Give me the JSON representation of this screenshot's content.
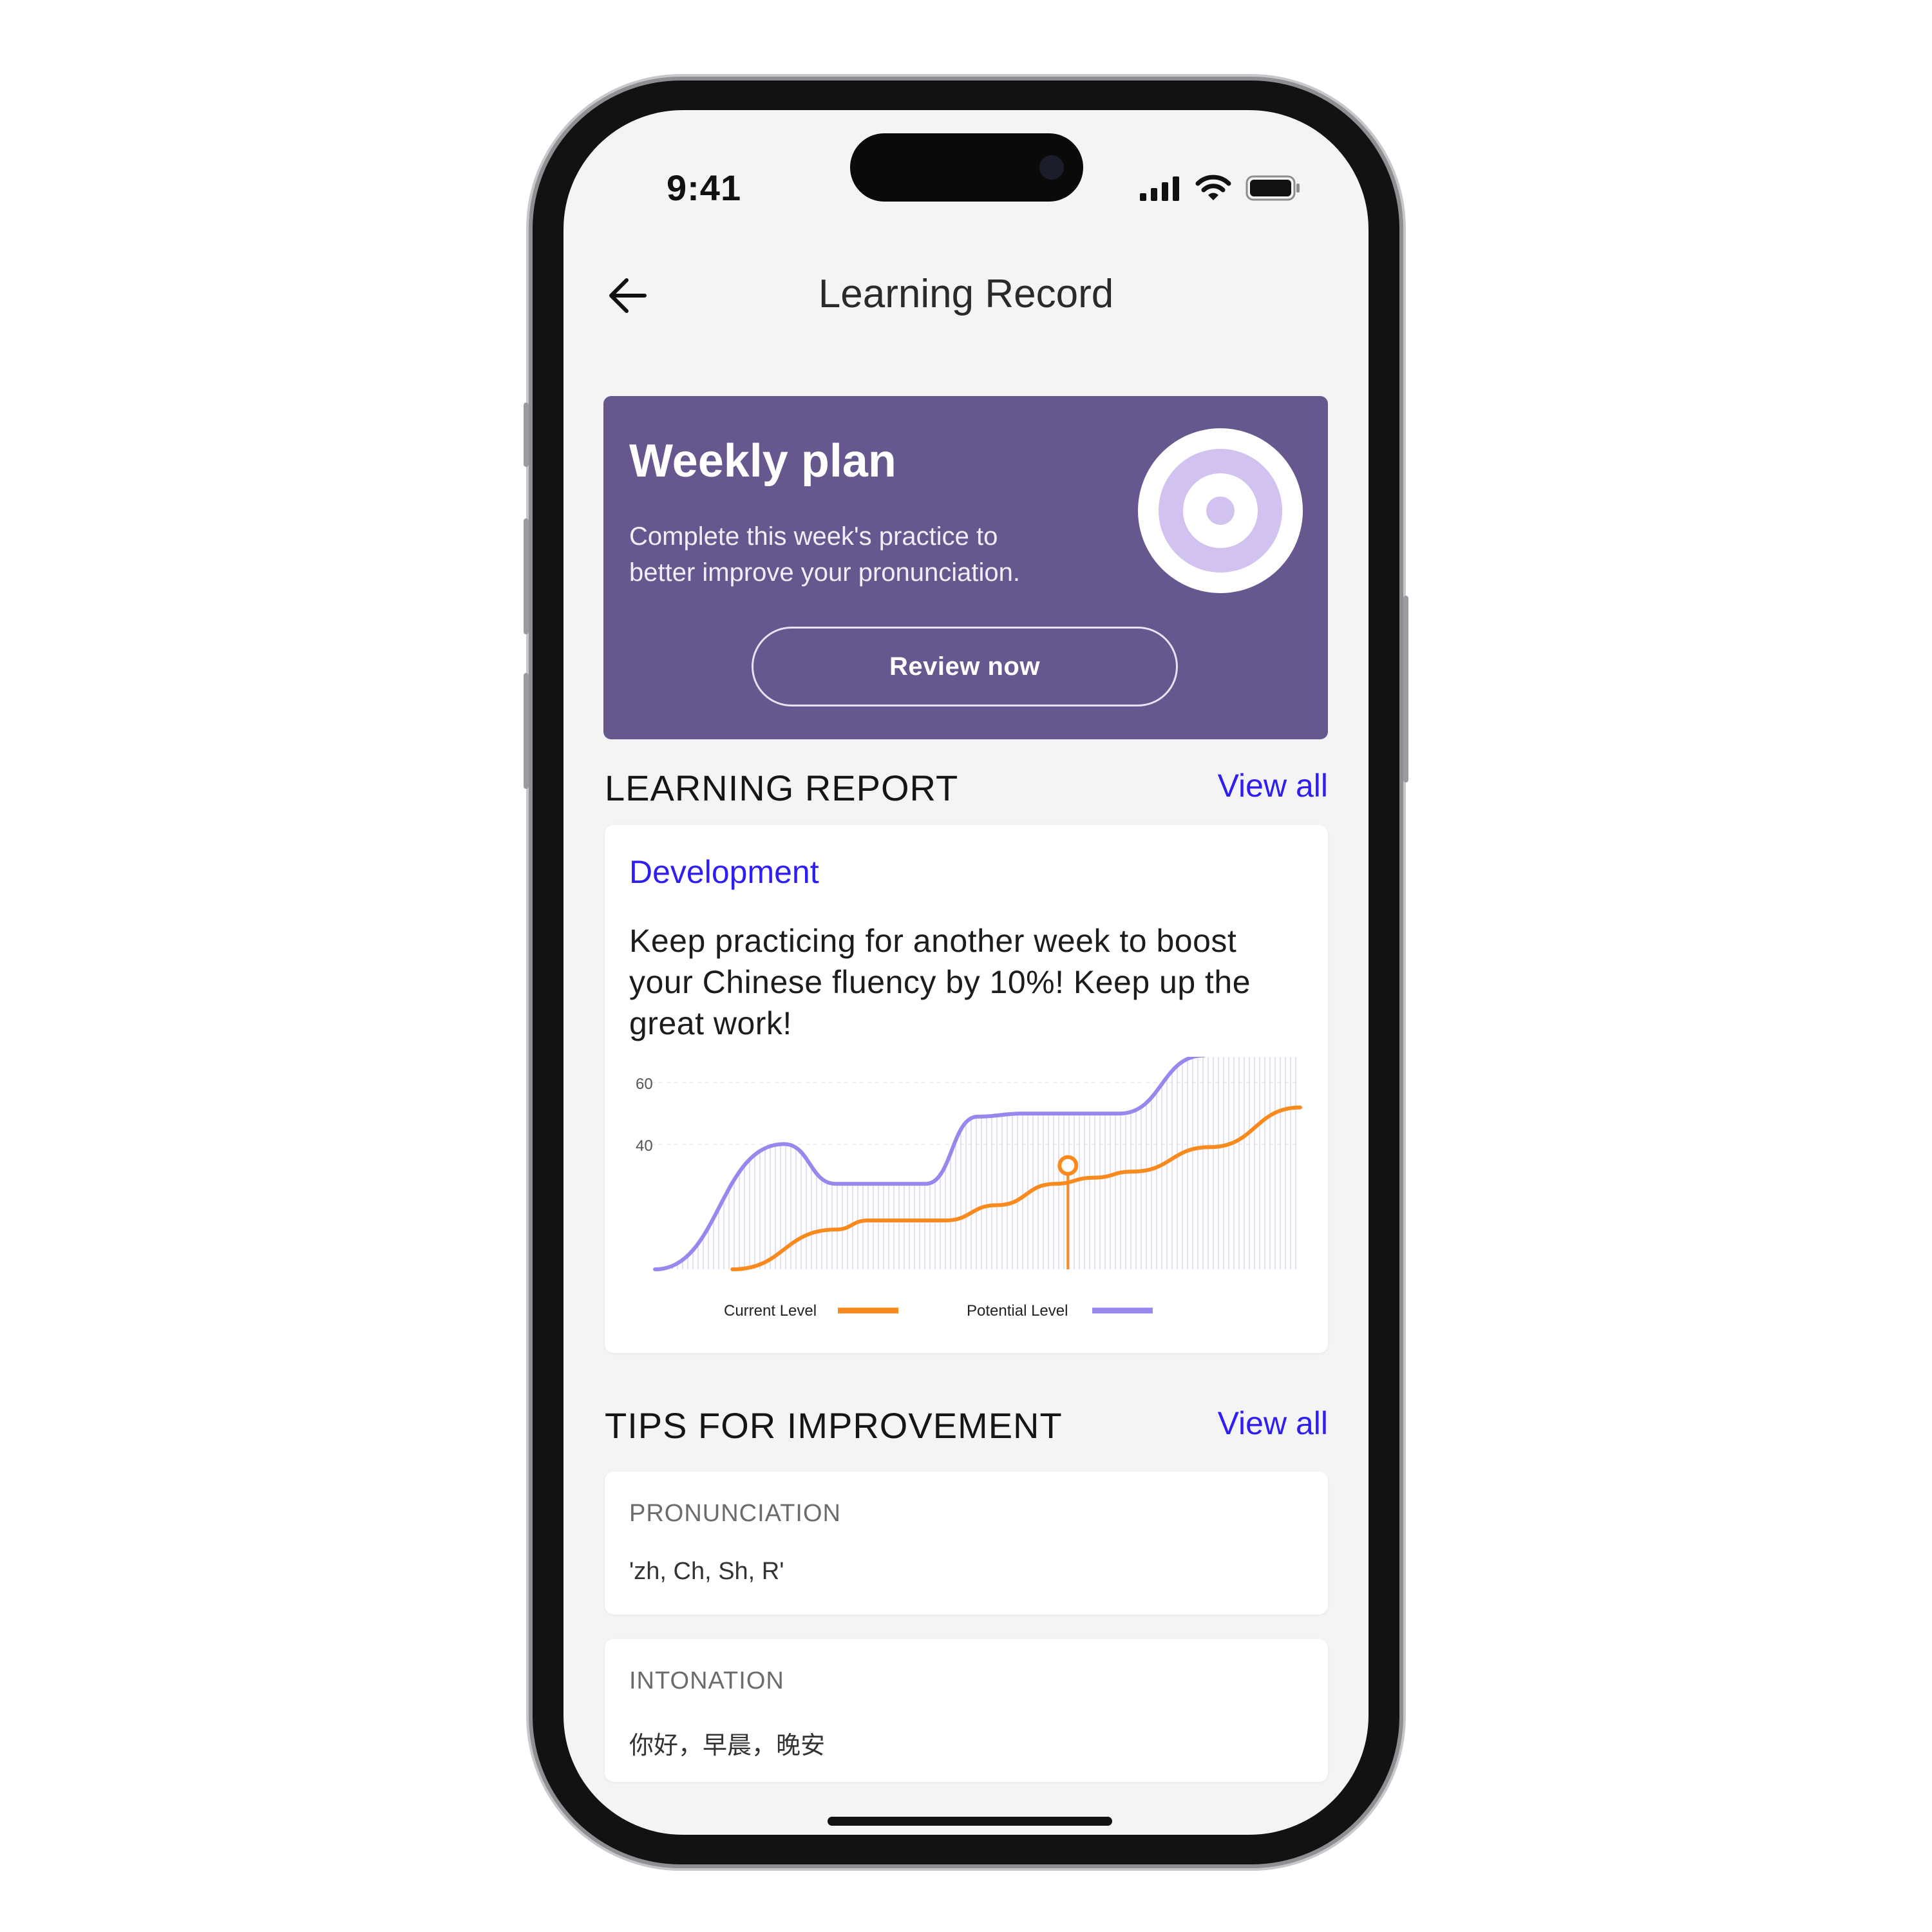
{
  "status_bar": {
    "time": "9:41"
  },
  "nav": {
    "title": "Learning Record"
  },
  "weekly_plan": {
    "title": "Weekly plan",
    "description_line1": "Complete this week's practice to",
    "description_line2": "better improve your pronunciation.",
    "button_label": "Review now",
    "card_color": "#66578e"
  },
  "learning_report": {
    "section_title": "LEARNING REPORT",
    "view_all": "View all",
    "subtitle": "Development",
    "message": "Keep practicing for another week to boost your Chinese fluency by 10%! Keep up the great work!"
  },
  "chart_data": {
    "type": "line",
    "ylim": [
      0,
      70
    ],
    "y_ticks": [
      "60",
      "40"
    ],
    "grid": true,
    "legend_position": "bottom",
    "series": [
      {
        "name": "Current Level",
        "color": "#f98a1d",
        "points": [
          [
            0.12,
            0
          ],
          [
            0.28,
            13
          ],
          [
            0.33,
            16
          ],
          [
            0.45,
            16
          ],
          [
            0.53,
            21
          ],
          [
            0.62,
            28
          ],
          [
            0.68,
            30
          ],
          [
            0.74,
            32
          ],
          [
            0.86,
            40
          ],
          [
            1.0,
            53
          ]
        ]
      },
      {
        "name": "Potential Level",
        "color": "#9688ec",
        "points": [
          [
            0,
            0
          ],
          [
            0.2,
            41
          ],
          [
            0.28,
            28
          ],
          [
            0.42,
            28
          ],
          [
            0.5,
            50
          ],
          [
            0.57,
            51
          ],
          [
            0.72,
            51
          ],
          [
            0.85,
            70
          ]
        ]
      }
    ],
    "highlight": {
      "series": "Current Level",
      "x": 0.64,
      "value": 34
    }
  },
  "tips": {
    "section_title": "TIPS FOR IMPROVEMENT",
    "view_all": "View all",
    "items": [
      {
        "label": "PRONUNCIATION",
        "value": "'zh, Ch, Sh, R'"
      },
      {
        "label": "INTONATION",
        "value": "你好，早晨，晚安"
      }
    ]
  },
  "colors": {
    "accent": "#2e1ef2",
    "background": "#f4f4f4"
  },
  "icons": [
    "back-arrow-icon",
    "signal-icon",
    "wifi-icon",
    "battery-icon",
    "target-icon"
  ]
}
